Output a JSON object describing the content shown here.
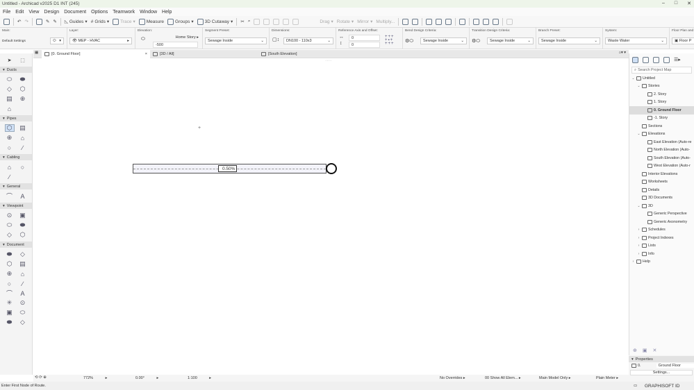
{
  "window": {
    "title": "Untitled - Archicad v2025 D1 INT (245)",
    "controls": [
      "–",
      "□",
      "✕"
    ]
  },
  "menu": [
    "File",
    "Edit",
    "View",
    "Design",
    "Document",
    "Options",
    "Teamwork",
    "Window",
    "Help"
  ],
  "toolbar": {
    "guides": "Guides",
    "grids": "Grids",
    "trace": "Trace",
    "measure": "Measure",
    "groups": "Groups",
    "cutaway": "3D Cutaway",
    "drag": "Drag",
    "rotate": "Rotate",
    "mirror": "Mirror",
    "multiply": "Multiply..."
  },
  "infobox": {
    "main_label": "Main:",
    "main_value": "Default Settings",
    "layer_label": "Layer:",
    "layer_value": "MEP - HVAC",
    "elevation_label": "Elevation:",
    "home_story": "Home Story",
    "elevation_value": "-500",
    "segment_label": "Segment Preset:",
    "segment_value": "Sewage Inside",
    "dimensions_label": "Dimensions:",
    "dimensions_value": "DN100 - 110x3",
    "refaxis_label": "Reference Axis and Offset:",
    "offset1": "0",
    "offset2": "0",
    "bend_label": "Bend Design Criteria:",
    "bend_value": "Sewage Inside",
    "transition_label": "Transition Design Criteria:",
    "transition_value": "Sewage Inside",
    "branch_label": "Branch Preset:",
    "branch_value": "Sewage Inside",
    "system_label": "System:",
    "system_value": "Waste Water",
    "floorplan_label": "Floor Plan and S",
    "floorplan_value": "Floor P"
  },
  "tabs": [
    {
      "label": "[0. Ground Floor]"
    },
    {
      "label": "[3D / All]"
    },
    {
      "label": "[South Elevation]"
    }
  ],
  "toolbox": {
    "sections": [
      {
        "name": "Ducts",
        "count": 7
      },
      {
        "name": "Pipes",
        "count": 6
      },
      {
        "name": "Cabling",
        "count": 3
      },
      {
        "name": "General",
        "count": 2
      },
      {
        "name": "Viewpoint",
        "count": 6
      },
      {
        "name": "Document",
        "count": 16
      }
    ]
  },
  "canvas": {
    "slope_label": "0.50%"
  },
  "navigator": {
    "search_placeholder": "Search Project Map",
    "tree": [
      {
        "label": "Untitled",
        "depth": 0,
        "chev": "v"
      },
      {
        "label": "Stories",
        "depth": 1,
        "chev": "v"
      },
      {
        "label": "2. Story",
        "depth": 2,
        "chev": ""
      },
      {
        "label": "1. Story",
        "depth": 2,
        "chev": ""
      },
      {
        "label": "0. Ground Floor",
        "depth": 2,
        "chev": "",
        "selected": true
      },
      {
        "label": "-1. Story",
        "depth": 2,
        "chev": ""
      },
      {
        "label": "Sections",
        "depth": 1,
        "chev": ""
      },
      {
        "label": "Elevations",
        "depth": 1,
        "chev": "v"
      },
      {
        "label": "East Elevation (Auto-re",
        "depth": 2,
        "chev": ""
      },
      {
        "label": "North Elevation (Auto-",
        "depth": 2,
        "chev": ""
      },
      {
        "label": "South Elevation (Auto-",
        "depth": 2,
        "chev": ""
      },
      {
        "label": "West Elevation (Auto-r",
        "depth": 2,
        "chev": ""
      },
      {
        "label": "Interior Elevations",
        "depth": 1,
        "chev": ""
      },
      {
        "label": "Worksheets",
        "depth": 1,
        "chev": ""
      },
      {
        "label": "Details",
        "depth": 1,
        "chev": ""
      },
      {
        "label": "3D Documents",
        "depth": 1,
        "chev": ""
      },
      {
        "label": "3D",
        "depth": 1,
        "chev": "v"
      },
      {
        "label": "Generic Perspective",
        "depth": 2,
        "chev": ""
      },
      {
        "label": "Generic Axonometry",
        "depth": 2,
        "chev": ""
      },
      {
        "label": "Schedules",
        "depth": 1,
        "chev": ">"
      },
      {
        "label": "Project Indexes",
        "depth": 1,
        "chev": ">"
      },
      {
        "label": "Lists",
        "depth": 1,
        "chev": ">"
      },
      {
        "label": "Info",
        "depth": 1,
        "chev": ">"
      },
      {
        "label": "Help",
        "depth": 0,
        "chev": ">"
      }
    ]
  },
  "properties": {
    "title": "Properties",
    "story_num": "0.",
    "story_name": "Ground Floor",
    "settings": "Settings..."
  },
  "statusbar": {
    "zoom": "772%",
    "angle": "0.00°",
    "scale": "1:100",
    "overrides": "No Overrides",
    "show": "00 Show All Elem...",
    "model": "Main Model Only",
    "meter": "Plain Meter"
  },
  "footer": {
    "hint": "Enter First Node of Route.",
    "brand": "GRAPHISOFT ID"
  }
}
